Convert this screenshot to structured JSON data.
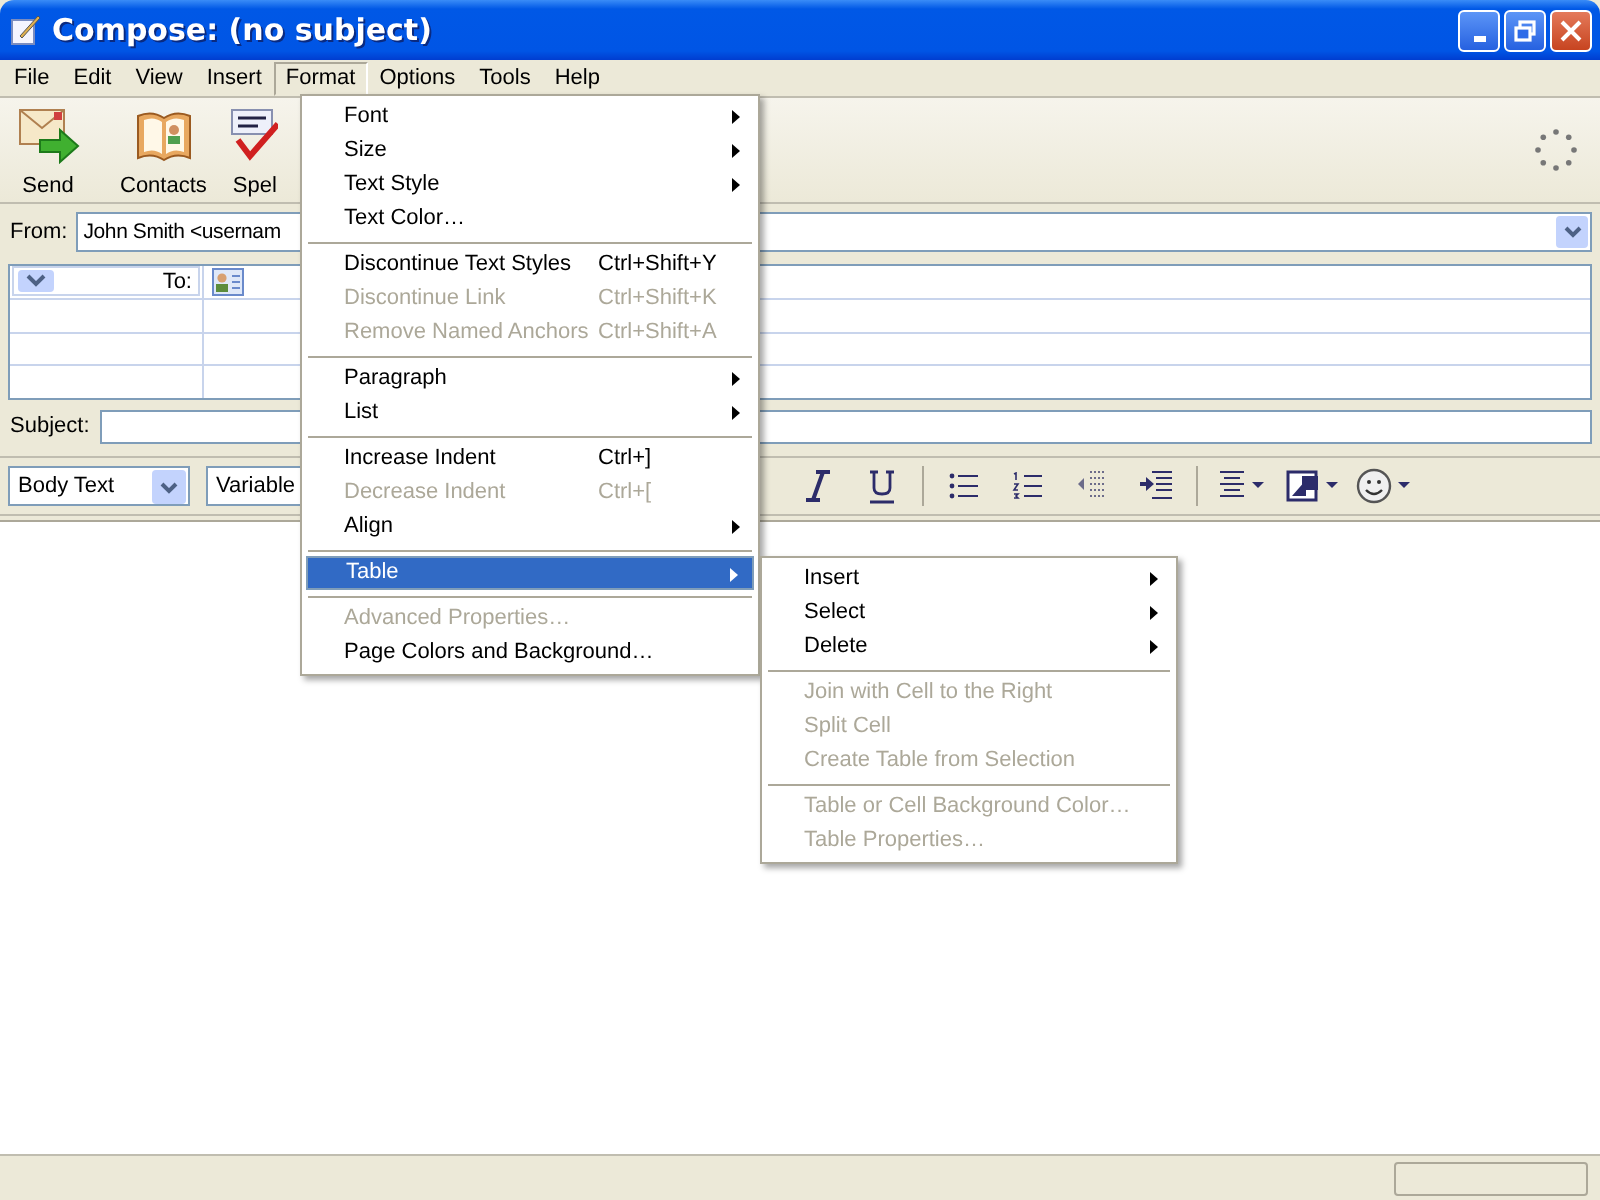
{
  "window": {
    "title": "Compose: (no subject)"
  },
  "menu_bar": [
    {
      "label": "File",
      "selected": false
    },
    {
      "label": "Edit",
      "selected": false
    },
    {
      "label": "View",
      "selected": false
    },
    {
      "label": "Insert",
      "selected": false
    },
    {
      "label": "Format",
      "selected": true
    },
    {
      "label": "Options",
      "selected": false
    },
    {
      "label": "Tools",
      "selected": false
    },
    {
      "label": "Help",
      "selected": false
    }
  ],
  "toolbar": [
    {
      "label": "Send",
      "kind": "send"
    },
    {
      "label": "Contacts",
      "kind": "contacts"
    },
    {
      "label": "Spel",
      "kind": "spell"
    }
  ],
  "from": {
    "label": "From:",
    "value": "John Smith <usernam"
  },
  "recipients": [
    {
      "type": "To:"
    }
  ],
  "subject": {
    "label": "Subject:"
  },
  "format_toolbar": {
    "paragraph_style": "Body Text",
    "font": "Variable"
  },
  "format_menu": [
    {
      "kind": "item",
      "label": "Font",
      "submenu": true,
      "disabled": false,
      "selected": false
    },
    {
      "kind": "item",
      "label": "Size",
      "submenu": true,
      "disabled": false,
      "selected": false
    },
    {
      "kind": "item",
      "label": "Text Style",
      "submenu": true,
      "disabled": false,
      "selected": false
    },
    {
      "kind": "item",
      "label": "Text Color…",
      "submenu": false,
      "disabled": false,
      "selected": false
    },
    {
      "kind": "separator"
    },
    {
      "kind": "item",
      "label": "Discontinue Text Styles",
      "shortcut": "Ctrl+Shift+Y",
      "submenu": false,
      "disabled": false,
      "selected": false
    },
    {
      "kind": "item",
      "label": "Discontinue Link",
      "shortcut": "Ctrl+Shift+K",
      "submenu": false,
      "disabled": true,
      "selected": false
    },
    {
      "kind": "item",
      "label": "Remove Named Anchors",
      "shortcut": "Ctrl+Shift+A",
      "submenu": false,
      "disabled": true,
      "selected": false
    },
    {
      "kind": "separator"
    },
    {
      "kind": "item",
      "label": "Paragraph",
      "submenu": true,
      "disabled": false,
      "selected": false
    },
    {
      "kind": "item",
      "label": "List",
      "submenu": true,
      "disabled": false,
      "selected": false
    },
    {
      "kind": "separator"
    },
    {
      "kind": "item",
      "label": "Increase Indent",
      "shortcut": "Ctrl+]",
      "submenu": false,
      "disabled": false,
      "selected": false
    },
    {
      "kind": "item",
      "label": "Decrease Indent",
      "shortcut": "Ctrl+[",
      "submenu": false,
      "disabled": true,
      "selected": false
    },
    {
      "kind": "item",
      "label": "Align",
      "submenu": true,
      "disabled": false,
      "selected": false
    },
    {
      "kind": "separator"
    },
    {
      "kind": "item",
      "label": "Table",
      "submenu": true,
      "disabled": false,
      "selected": true
    },
    {
      "kind": "separator"
    },
    {
      "kind": "item",
      "label": "Advanced Properties…",
      "submenu": false,
      "disabled": true,
      "selected": false
    },
    {
      "kind": "item",
      "label": "Page Colors and Background…",
      "submenu": false,
      "disabled": false,
      "selected": false
    }
  ],
  "table_submenu": [
    {
      "kind": "item",
      "label": "Insert",
      "submenu": true,
      "disabled": false
    },
    {
      "kind": "item",
      "label": "Select",
      "submenu": true,
      "disabled": false
    },
    {
      "kind": "item",
      "label": "Delete",
      "submenu": true,
      "disabled": false
    },
    {
      "kind": "separator"
    },
    {
      "kind": "item",
      "label": "Join with Cell to the Right",
      "submenu": false,
      "disabled": true
    },
    {
      "kind": "item",
      "label": "Split Cell",
      "submenu": false,
      "disabled": true
    },
    {
      "kind": "item",
      "label": "Create Table from Selection",
      "submenu": false,
      "disabled": true
    },
    {
      "kind": "separator"
    },
    {
      "kind": "item",
      "label": "Table or Cell Background Color…",
      "submenu": false,
      "disabled": true
    },
    {
      "kind": "item",
      "label": "Table Properties…",
      "submenu": false,
      "disabled": true
    }
  ]
}
